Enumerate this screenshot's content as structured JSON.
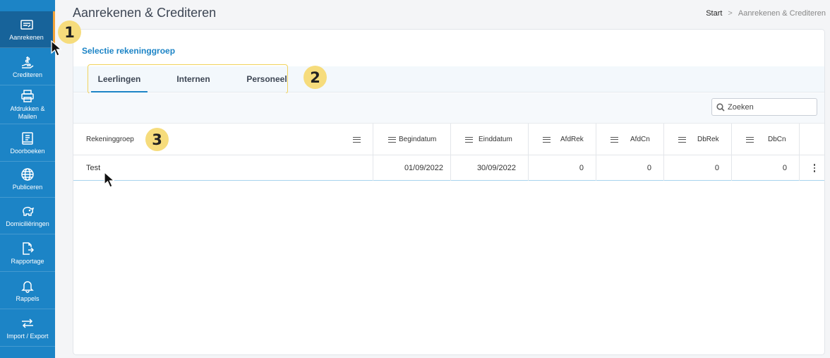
{
  "sidebar": {
    "items": [
      {
        "label": "Aanrekenen",
        "icon": "invoice-icon",
        "active": true
      },
      {
        "label": "Crediteren",
        "icon": "hand-money-icon"
      },
      {
        "label": "Afdrukken & Mailen",
        "icon": "printer-icon"
      },
      {
        "label": "Doorboeken",
        "icon": "ledger-book-icon"
      },
      {
        "label": "Publiceren",
        "icon": "globe-icon"
      },
      {
        "label": "Domiciliëringen",
        "icon": "piggy-bank-icon"
      },
      {
        "label": "Rapportage",
        "icon": "report-export-icon"
      },
      {
        "label": "Rappels",
        "icon": "bell-icon"
      },
      {
        "label": "Import / Export",
        "icon": "transfer-arrows-icon"
      }
    ]
  },
  "header": {
    "title": "Aanrekenen & Crediteren",
    "breadcrumb": {
      "start": "Start",
      "separator": ">",
      "current": "Aanrekenen & Crediteren"
    }
  },
  "main": {
    "section_title": "Selectie rekeninggroep",
    "tabs": [
      {
        "label": "Leerlingen",
        "active": true
      },
      {
        "label": "Internen"
      },
      {
        "label": "Personeel"
      }
    ],
    "search": {
      "placeholder": "Zoeken",
      "value": ""
    },
    "table": {
      "columns": [
        "Rekeninggroep",
        "Begindatum",
        "Einddatum",
        "AfdRek",
        "AfdCn",
        "DbRek",
        "DbCn"
      ],
      "rows": [
        {
          "rekeninggroep": "Test",
          "begindatum": "01/09/2022",
          "einddatum": "30/09/2022",
          "afdrek": "0",
          "afdcn": "0",
          "dbrek": "0",
          "dbcn": "0"
        }
      ]
    }
  },
  "annotations": {
    "badge1": "1",
    "badge2": "2",
    "badge3": "3"
  },
  "colors": {
    "primary": "#1c84c6",
    "sidebar_active": "#17639a",
    "highlight": "#f6dc7c",
    "active_indicator": "#f0a33a"
  }
}
